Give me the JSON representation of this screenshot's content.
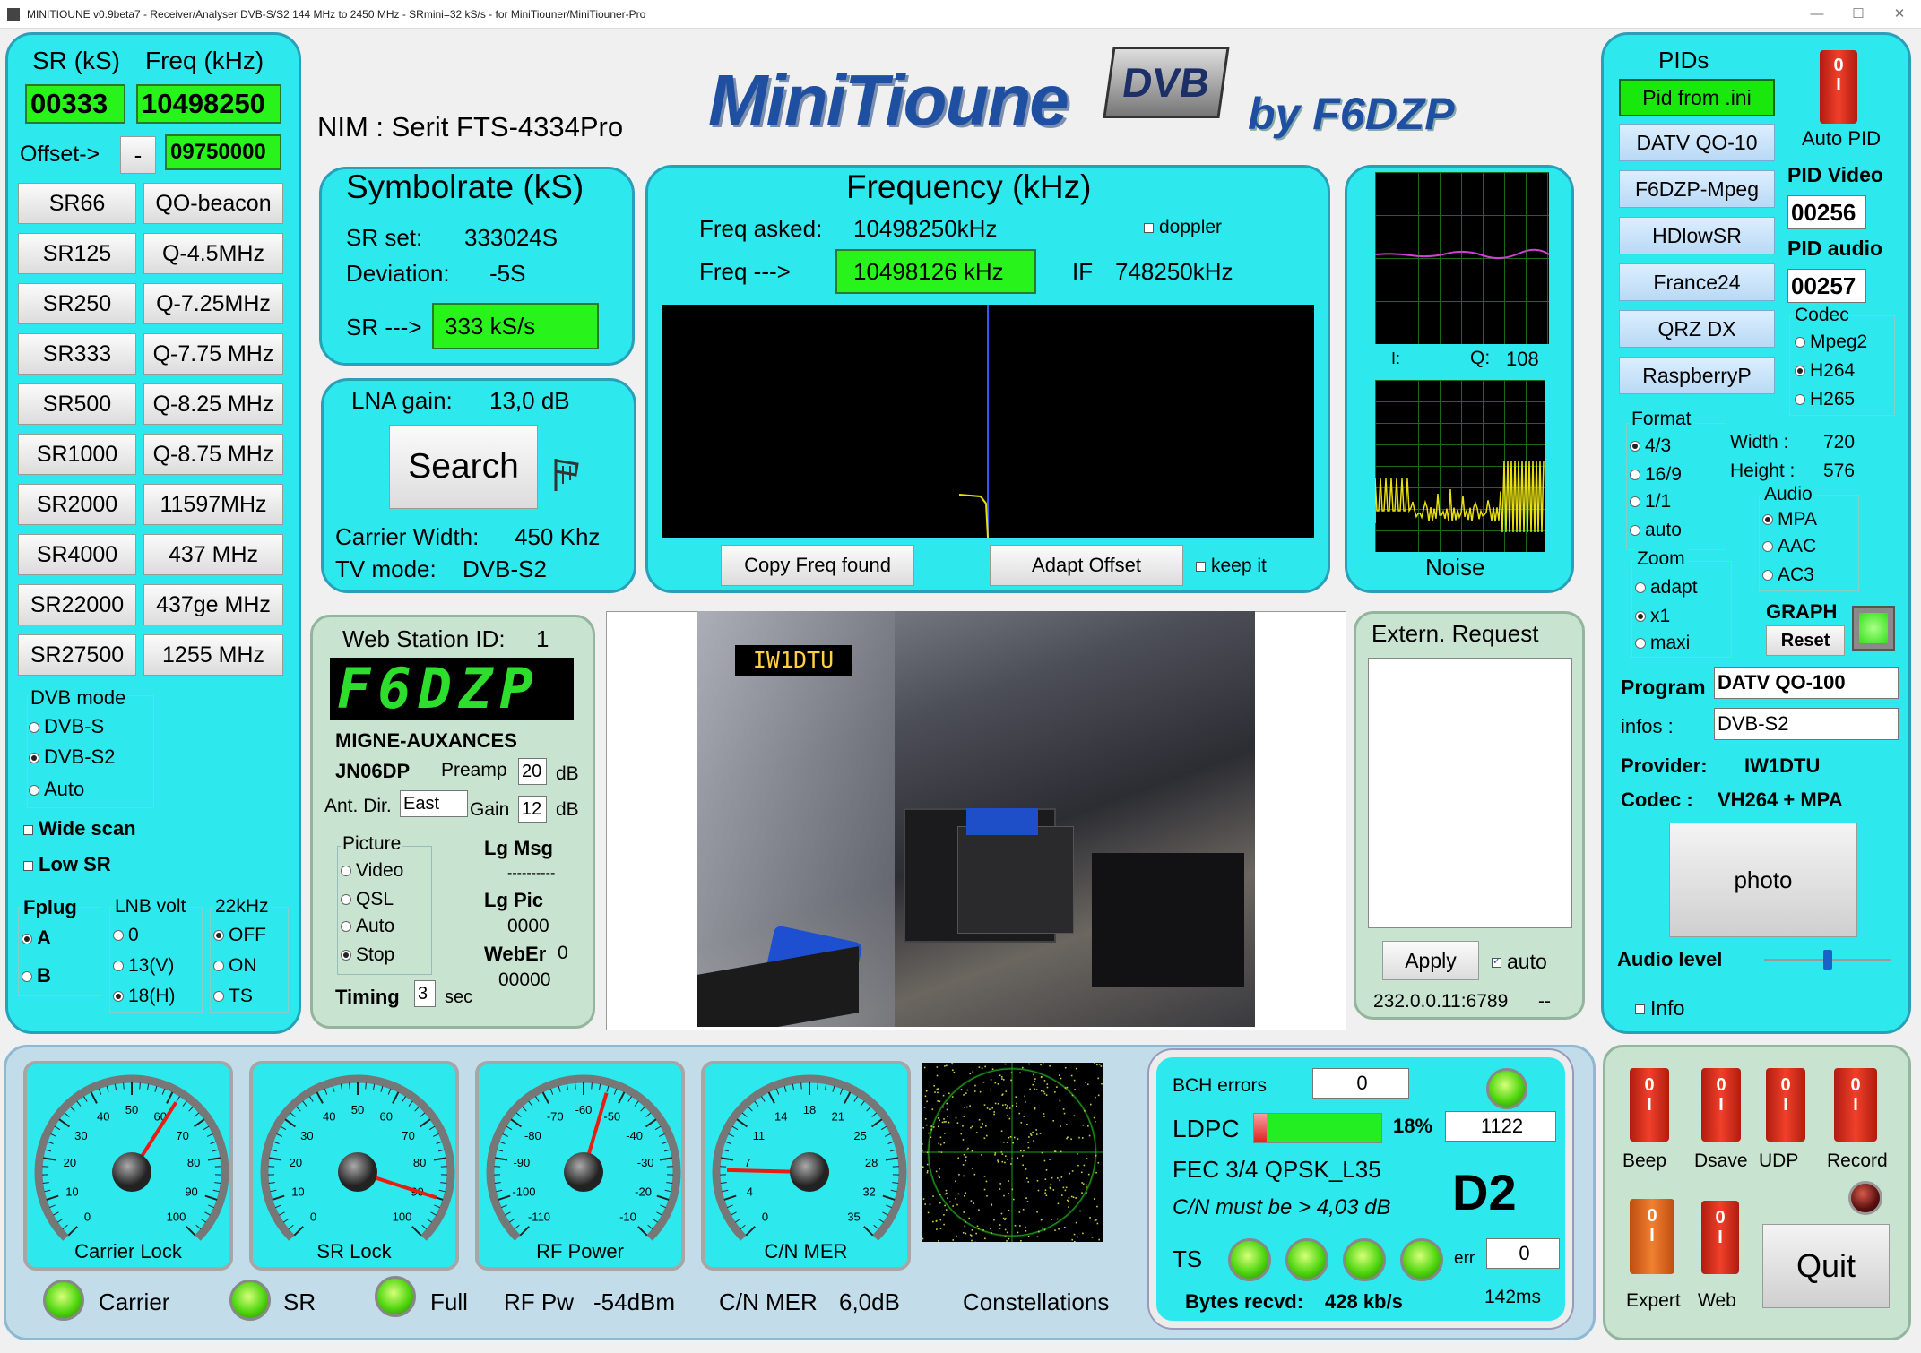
{
  "title": "MINITIOUNE v0.9beta7 - Receiver/Analyser DVB-S/S2 144 MHz to 2450 MHz - SRmini=32 kS/s - for MiniTiouner/MiniTiouner-Pro",
  "left": {
    "sr_label": "SR (kS)",
    "freq_label": "Freq (kHz)",
    "sr_value": "00333",
    "freq_value": "10498250",
    "offset_label": "Offset->",
    "offset_sign": "-",
    "offset_value": "09750000",
    "sr_buttons": [
      "SR66",
      "SR125",
      "SR250",
      "SR333",
      "SR500",
      "SR1000",
      "SR2000",
      "SR4000",
      "SR22000",
      "SR27500"
    ],
    "freq_buttons": [
      "QO-beacon",
      "Q-4.5MHz",
      "Q-7.25MHz",
      "Q-7.75 MHz",
      "Q-8.25 MHz",
      "Q-8.75 MHz",
      "11597MHz",
      "437 MHz",
      "437ge MHz",
      "1255 MHz"
    ],
    "dvb_mode_title": "DVB mode",
    "dvb_modes": [
      "DVB-S",
      "DVB-S2",
      "Auto"
    ],
    "wide_scan": "Wide scan",
    "low_sr": "Low SR",
    "fplug_title": "Fplug",
    "fplug": [
      "A",
      "B"
    ],
    "lnb_title": "LNB volt",
    "lnb": [
      "0",
      "13(V)",
      "18(H)"
    ],
    "k22_title": "22kHz",
    "k22": [
      "OFF",
      "ON",
      "TS"
    ]
  },
  "header": {
    "nim": "NIM : Serit FTS-4334Pro",
    "logo_main": "MiniTioune",
    "logo_badge": "DVB",
    "logo_by": "by F6DZP"
  },
  "symbol": {
    "title": "Symbolrate (kS)",
    "sr_set_label": "SR set:",
    "sr_set": "333024S",
    "deviation_label": "Deviation:",
    "deviation": "-5S",
    "sr_arrow": "SR --->",
    "sr_value": "333 kS/s"
  },
  "search": {
    "lna_label": "LNA gain:",
    "lna_value": "13,0 dB",
    "search_button": "Search",
    "carrier_label": "Carrier Width:",
    "carrier_value": "450 Khz",
    "tv_label": "TV mode:",
    "tv_value": "DVB-S2"
  },
  "frequency": {
    "title": "Frequency (kHz)",
    "asked_label": "Freq asked:",
    "asked": "10498250kHz",
    "doppler": "doppler",
    "arrow_label": "Freq --->",
    "found": "10498126 kHz",
    "if_label": "IF",
    "if_value": "748250kHz",
    "copy_btn": "Copy Freq found",
    "adapt_btn": "Adapt Offset",
    "keep": "keep it"
  },
  "scopes": {
    "i_label": "I:",
    "q_label": "Q:",
    "q_value": "108",
    "noise": "Noise"
  },
  "web": {
    "title": "Web Station ID:",
    "id": "1",
    "callsign": "F6DZP",
    "location": "MIGNE-AUXANCES",
    "locator": "JN06DP",
    "preamp_label": "Preamp",
    "preamp": "20",
    "db1": "dB",
    "ant_label": "Ant. Dir.",
    "ant": "East",
    "gain_label": "Gain",
    "gain": "12",
    "db2": "dB",
    "picture_title": "Picture",
    "picture": [
      "Video",
      "QSL",
      "Auto",
      "Stop"
    ],
    "lg_msg": "Lg Msg",
    "lg_msg_val": "----------",
    "lg_pic": "Lg Pic",
    "lg_pic_val": "0000",
    "weber": "WebEr",
    "weber_val": "0",
    "weber_val2": "00000",
    "timing": "Timing",
    "timing_val": "3",
    "sec": "sec"
  },
  "video": {
    "overlay": "IW1DTU"
  },
  "extern": {
    "title": "Extern. Request",
    "apply": "Apply",
    "auto": "auto",
    "address": "232.0.0.11:6789",
    "dashes": "--"
  },
  "pids": {
    "title": "PIDs",
    "auto_pid": "Auto PID",
    "presets": [
      "Pid from .ini",
      "DATV QO-10",
      "F6DZP-Mpeg",
      "HDlowSR",
      "France24",
      "QRZ DX",
      "RaspberryP"
    ],
    "pid_video_label": "PID Video",
    "pid_video": "00256",
    "pid_audio_label": "PID audio",
    "pid_audio": "00257",
    "codec_title": "Codec",
    "codecs": [
      "Mpeg2",
      "H264",
      "H265"
    ],
    "format_title": "Format",
    "formats": [
      "4/3",
      "16/9",
      "1/1",
      "auto"
    ],
    "width_label": "Width :",
    "width": "720",
    "height_label": "Height :",
    "height": "576",
    "audio_title": "Audio",
    "audios": [
      "MPA",
      "AAC",
      "AC3"
    ],
    "zoom_title": "Zoom",
    "zooms": [
      "adapt",
      "x1",
      "maxi"
    ],
    "graph": "GRAPH",
    "reset": "Reset",
    "program_label": "Program",
    "program": "DATV QO-100",
    "infos_label": "infos :",
    "infos": "DVB-S2",
    "provider_label": "Provider:",
    "provider": "IW1DTU",
    "codec_label": "Codec :",
    "codec": "VH264 + MPA",
    "photo": "photo",
    "audio_level": "Audio level",
    "info": "Info"
  },
  "gauges": [
    {
      "label": "Carrier Lock",
      "ticks": [
        "0",
        "10",
        "20",
        "30",
        "40",
        "50",
        "60",
        "70",
        "80",
        "90",
        "100"
      ],
      "value": 62
    },
    {
      "label": "SR Lock",
      "ticks": [
        "0",
        "10",
        "20",
        "30",
        "40",
        "50",
        "60",
        "70",
        "80",
        "90",
        "100"
      ],
      "value": 90
    },
    {
      "label": "RF Power",
      "ticks": [
        "-110",
        "-100",
        "-90",
        "-80",
        "-70",
        "-60",
        "-50",
        "-40",
        "-30",
        "-20",
        "-10"
      ],
      "value": -54
    },
    {
      "label": "C/N MER",
      "ticks": [
        "0",
        "4",
        "7",
        "11",
        "14",
        "18",
        "21",
        "25",
        "28",
        "32",
        "35"
      ],
      "value": 6
    }
  ],
  "status": {
    "carrier": "Carrier",
    "sr": "SR",
    "full": "Full",
    "rf_pw": "RF Pw",
    "rf_pw_val": "-54dBm",
    "cn_mer": "C/N MER",
    "cn_mer_val": "6,0dB",
    "constellations": "Constellations"
  },
  "decoder": {
    "bch_label": "BCH errors",
    "bch": "0",
    "ldpc_label": "LDPC",
    "ldpc_pct": "18%",
    "ldpc_fill": 0.18,
    "ldpc_val": "1122",
    "fec": "FEC  3/4 QPSK_L35",
    "cn_must": "C/N must be > 4,03 dB",
    "d2": "D2",
    "ts": "TS",
    "err": "err",
    "err_val": "0",
    "bytes_label": "Bytes recvd:",
    "bytes": "428 kb/s",
    "ms": "142ms"
  },
  "controls": {
    "switches": [
      "Beep",
      "Dsave",
      "UDP",
      "Record"
    ],
    "expert": "Expert",
    "web": "Web",
    "quit": "Quit"
  },
  "colors": {
    "panel": "#2de9ee",
    "green": "#28f31a",
    "accent_red": "#e8301c"
  }
}
